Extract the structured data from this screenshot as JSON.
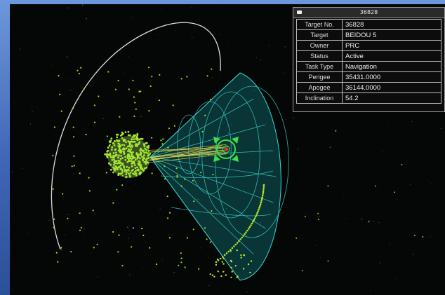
{
  "window": {
    "title": "36828"
  },
  "info_table": {
    "rows": [
      {
        "label": "Target No.",
        "value": "36828"
      },
      {
        "label": "Target",
        "value": "BEIDOU 5"
      },
      {
        "label": "Owner",
        "value": "PRC"
      },
      {
        "label": "Status",
        "value": "Active"
      },
      {
        "label": "Task Type",
        "value": "Navigation"
      },
      {
        "label": "Perigee",
        "value": "35431.0000"
      },
      {
        "label": "Apogee",
        "value": "36144.0000"
      },
      {
        "label": "Inclination",
        "value": "54.2"
      }
    ]
  },
  "colors": {
    "space": "#050706",
    "sensor_cone": "#1fb8b0",
    "satellite_dots": "#9bdc2a",
    "orbit": "#ffffff",
    "target_marker": "#38e04a",
    "los_lines": "#e3d84a",
    "panel_bg": "#0c0c0c",
    "frame": "#4f78c8"
  },
  "scene": {
    "icons": [
      "earth-globe",
      "sensor-cone",
      "target-reticle",
      "orbit-path"
    ]
  }
}
